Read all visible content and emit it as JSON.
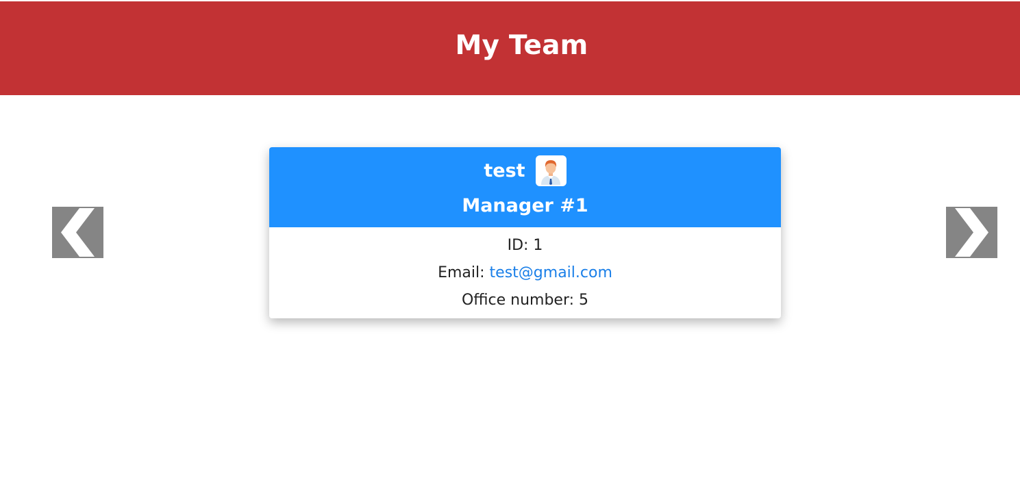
{
  "header": {
    "title": "My Team"
  },
  "carousel": {
    "prev_icon": "chevron-left-icon",
    "next_icon": "chevron-right-icon",
    "arrow_color": "#858585"
  },
  "card": {
    "name": "test",
    "role": "Manager #1",
    "avatar_icon": "manager-avatar-icon",
    "header_color": "#1f91ff",
    "id_label": "ID:",
    "id_value": "1",
    "email_label": "Email:",
    "email_value": "test@gmail.com",
    "office_label": "Office number:",
    "office_value": "5"
  },
  "colors": {
    "header_bg": "#c23234",
    "link": "#1a7fe8"
  }
}
